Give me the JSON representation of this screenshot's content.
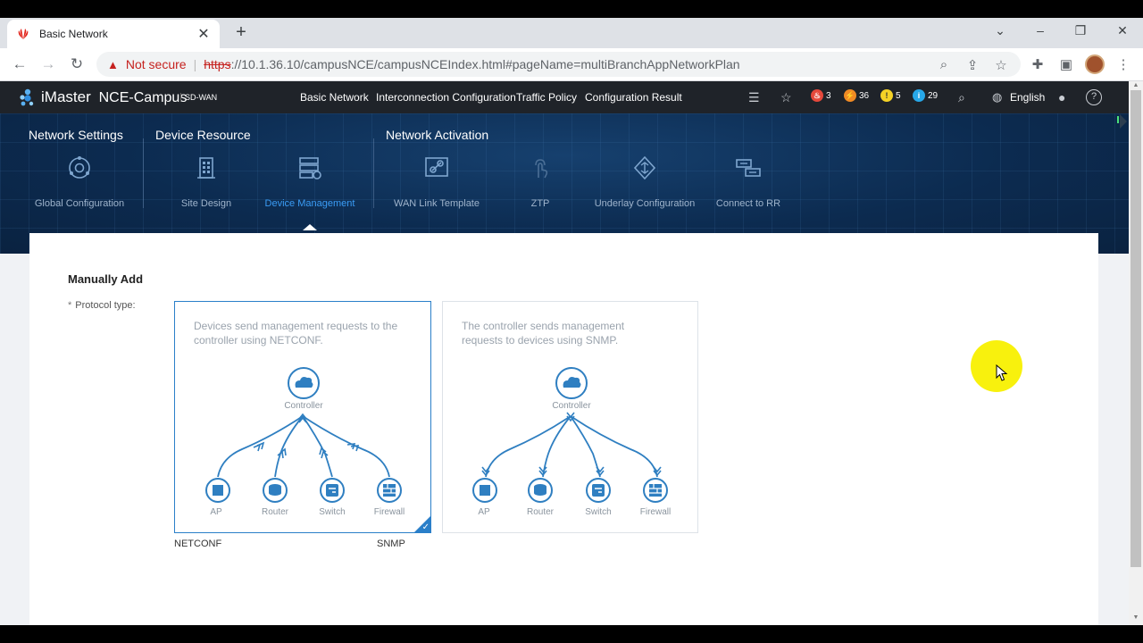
{
  "browser": {
    "tab_title": "Basic Network",
    "security_label": "Not secure",
    "url_scheme": "https",
    "url_rest": "://10.1.36.10/campusNCE/campusNCEIndex.html#pageName=multiBranchAppNetworkPlan"
  },
  "app": {
    "brand": "iMaster",
    "product": "NCE-Campus",
    "tag": "SD-WAN",
    "nav": [
      "Basic Network",
      "Interconnection Configuration",
      "Traffic Policy",
      "Configuration Result"
    ],
    "alarms": {
      "critical": "3",
      "major": "36",
      "minor": "5",
      "info": "29"
    },
    "language": "English"
  },
  "banner": {
    "groups": [
      "Network Settings",
      "Device Resource",
      "Network Activation"
    ],
    "steps": [
      {
        "label": "Global Configuration",
        "icon": "global-config-icon"
      },
      {
        "label": "Site Design",
        "icon": "building-icon"
      },
      {
        "label": "Device Management",
        "icon": "server-gear-icon",
        "active": true
      },
      {
        "label": "WAN Link Template",
        "icon": "link-icon"
      },
      {
        "label": "ZTP",
        "icon": "touch-icon"
      },
      {
        "label": "Underlay Configuration",
        "icon": "underlay-icon"
      },
      {
        "label": "Connect to RR",
        "icon": "connect-rr-icon"
      }
    ]
  },
  "form": {
    "section_title": "Manually Add",
    "required_mark": "*",
    "protocol_label": "Protocol type:",
    "cards": [
      {
        "desc": "Devices send management requests to the controller using NETCONF.",
        "caption": "NETCONF",
        "selected": true
      },
      {
        "desc": "The controller sends management requests to devices using SNMP.",
        "caption": "SNMP",
        "selected": false
      }
    ],
    "diagram": {
      "controller": "Controller",
      "devices": [
        "AP",
        "Router",
        "Switch",
        "Firewall"
      ]
    }
  },
  "colors": {
    "accent": "#2a7fc9",
    "banner": "#0c2b50",
    "header": "#1f2329",
    "not_secure": "#c5221f"
  }
}
